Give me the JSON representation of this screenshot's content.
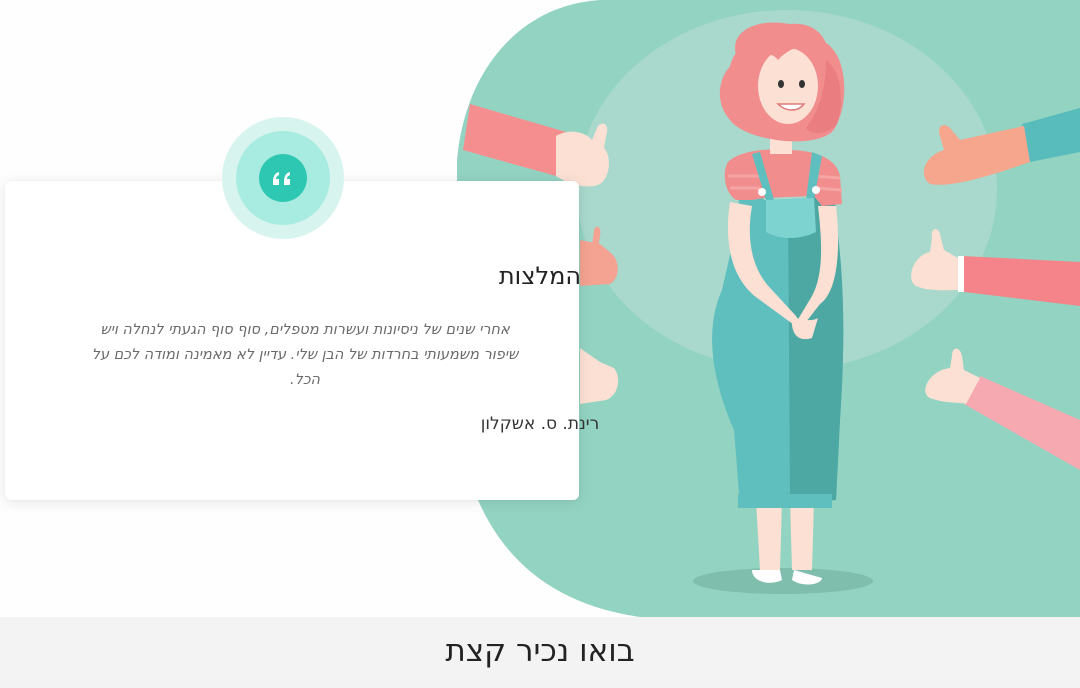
{
  "testimonials": {
    "title": "המלצות",
    "quote_icon": "quote-icon",
    "items": [
      {
        "text": "אחרי שנים של ניסיונות ועשרות מטפלים, סוף סוף הגעתי לנחלה ויש שיפור משמעותי בחרדות של הבן שלי. עדיין לא מאמינה ומודה לכם על הכל.",
        "author": "רינת. ס. אשקלון"
      }
    ]
  },
  "illustration": {
    "subject": "woman-with-thumbs-up-illustration"
  },
  "colors": {
    "mint_background": "#93d3c2",
    "accent_teal": "#2ec8b2",
    "footer_bg": "#f3f3f3"
  },
  "next_section": {
    "title": "בואו נכיר קצת"
  }
}
